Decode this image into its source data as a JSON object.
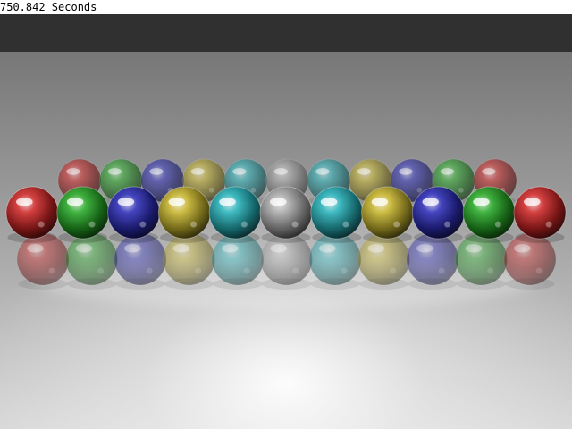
{
  "status": {
    "render_time": "750.842 Seconds"
  },
  "scene": {
    "colors": {
      "backdrop_top": "#303030",
      "backdrop_floor_dark": "#767676",
      "backdrop_floor_light": "#f2f2f2",
      "red": "#d01818",
      "green": "#1aa81a",
      "blue": "#2020b8",
      "yellow": "#c8b420",
      "cyan": "#18b0b8",
      "gray": "#a8a8a8"
    },
    "back_row": [
      "red",
      "green",
      "blue",
      "yellow",
      "cyan",
      "gray",
      "cyan",
      "yellow",
      "blue",
      "green",
      "red"
    ],
    "middle_row": [
      "red",
      "green",
      "blue",
      "yellow",
      "cyan",
      "gray",
      "cyan",
      "yellow",
      "blue",
      "green",
      "red"
    ],
    "front_row": [
      "red",
      "green",
      "blue",
      "yellow",
      "cyan",
      "gray",
      "cyan",
      "yellow",
      "blue",
      "green",
      "red"
    ]
  }
}
